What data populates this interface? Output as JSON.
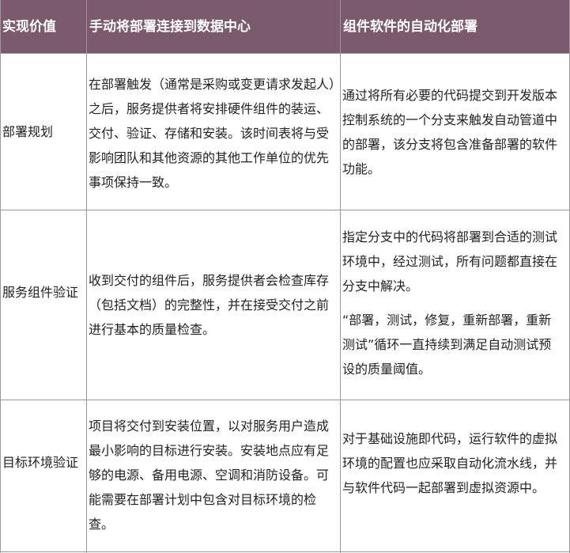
{
  "table": {
    "headers": [
      "实现价值",
      "手动将部署连接到数据中心",
      "组件软件的自动化部署"
    ],
    "rows": [
      {
        "label": "部署规划",
        "manual": [
          "在部署触发（通常是采购或变更请求发起人）之后，服务提供者将安排硬件组件的装运、交付、验证、存储和安装。该时间表将与受影响团队和其他资源的其他工作单位的优先事项保持一致。"
        ],
        "auto": [
          "通过将所有必要的代码提交到开发版本控制系统的一个分支来触发自动管道中的部署，该分支将包含准备部署的软件功能。"
        ]
      },
      {
        "label": "服务组件验证",
        "manual": [
          "收到交付的组件后，服务提供者会检查库存（包括文档）的完整性，并在接受交付之前进行基本的质量检查。"
        ],
        "auto": [
          "指定分支中的代码将部署到合适的测试环境中，经过测试，所有问题都直接在分支中解决。",
          "“部署，测试，修复，重新部署，重新测试”循环一直持续到满足自动测试预设的质量阈值。"
        ]
      },
      {
        "label": "目标环境验证",
        "manual": [
          "项目将交付到安装位置，以对服务用户造成最小影响的目标进行安装。安装地点应有足够的电源、备用电源、空调和消防设备。可能需要在部署计划中包含对目标环境的检查。"
        ],
        "auto": [
          "对于基础设施即代码，运行软件的虚拟环境的配置也应采取自动化流水线，并与软件代码一起部署到虚拟资源中。"
        ]
      }
    ]
  },
  "colors": {
    "header_bg": "#7b5a6e",
    "header_text": "#ffffff",
    "border": "#9a9a9a",
    "body_text": "#222222"
  }
}
